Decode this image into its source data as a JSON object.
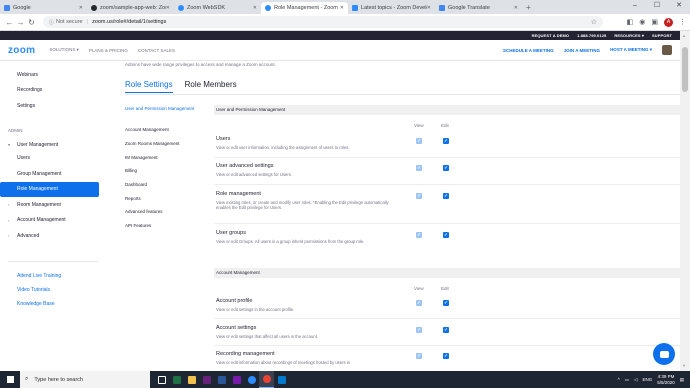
{
  "browser": {
    "tabs": [
      {
        "label": "Google",
        "color": "#4285f4"
      },
      {
        "label": "zoom/sample-app-web: Zoom V",
        "color": "#24292e"
      },
      {
        "label": "Zoom WebSDK",
        "color": "#2d8cff"
      },
      {
        "label": "Role Management - Zoom",
        "color": "#2d8cff"
      },
      {
        "label": "Latest topics - Zoom Developer",
        "color": "#2d8cff"
      },
      {
        "label": "Google Translate",
        "color": "#4285f4"
      }
    ],
    "active_tab": 3,
    "not_secure": "Not secure",
    "url": "zoom.us/role#/detail/1/settings",
    "profile_initial": "A"
  },
  "topbar": {
    "links": [
      "REQUEST A DEMO",
      "1.888.799.0125",
      "RESOURCES",
      "SUPPORT"
    ]
  },
  "nav": {
    "logo": "zoom",
    "links": [
      "SOLUTIONS",
      "PLANS & PRICING",
      "CONTACT SALES"
    ],
    "right_links": [
      "SCHEDULE A MEETING",
      "JOIN A MEETING",
      "HOST A MEETING"
    ]
  },
  "sidebar": {
    "items": [
      "Webinars",
      "Recordings",
      "Settings"
    ],
    "admin_heading": "ADMIN",
    "user_management": "User Management",
    "user_children": [
      "Users",
      "Group Management",
      "Role Management"
    ],
    "collapsed": [
      "Room Management",
      "Account Management",
      "Advanced"
    ],
    "links": [
      "Attend Live Training",
      "Video Tutorials",
      "Knowledge Base"
    ]
  },
  "main": {
    "intro": "Admins have wide range privileges to access and manage a Zoom account.",
    "tabs": [
      "Role Settings",
      "Role Members"
    ],
    "subnav": [
      "User and Permission Management",
      "Account Management",
      "Zoom Rooms Management",
      "IM Management",
      "Billing",
      "Dashboard",
      "Reports",
      "Advanced features",
      "API Features"
    ],
    "col_view": "View",
    "col_edit": "Edit",
    "sections": [
      {
        "title": "User and Permission Management",
        "rows": [
          {
            "title": "Users",
            "desc": "View or edit user information, including the assignment of users to roles."
          },
          {
            "title": "User advanced settings",
            "desc": "View or edit advanced settings for Users."
          },
          {
            "title": "Role management",
            "desc": "View existing roles, or create and modify user roles. *Enabling the Edit privilege automatically enables the Edit privilege for Users."
          },
          {
            "title": "User groups",
            "desc": "View or edit Groups. All users in a group inherit permissions from the group role."
          }
        ]
      },
      {
        "title": "Account Management",
        "rows": [
          {
            "title": "Account profile",
            "desc": "View or edit settings in the account profile."
          },
          {
            "title": "Account settings",
            "desc": "View or edit settings that affect all users in the account."
          },
          {
            "title": "Recording management",
            "desc": "View or edit information about recordings of meetings hosted by users in"
          }
        ]
      }
    ]
  },
  "taskbar": {
    "search_placeholder": "Type here to search",
    "lang": "ENG",
    "time": "4:39 PM",
    "date": "5/5/2020"
  }
}
